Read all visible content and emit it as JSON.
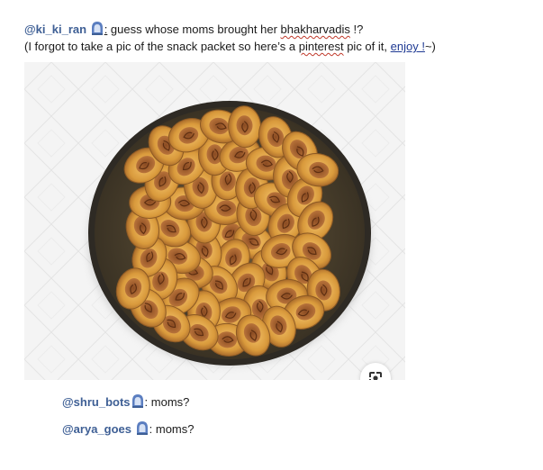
{
  "post": {
    "author": "@ki_ki_ran",
    "author_separator": ":",
    "line1_before": " guess whose moms brought her ",
    "line1_squiggle_word": "bhakharvadis",
    "line1_after": " !?",
    "line2_before": "(I forgot to take a pic of the snack packet so here’s a ",
    "line2_squiggle_word": "pinterest",
    "line2_middle": " pic of it, ",
    "line2_link": "enjoy !",
    "line2_after": "~)"
  },
  "image": {
    "subject": "bowl of bhakharvadi snacks",
    "lens_icon": "google-lens-icon"
  },
  "replies": [
    {
      "author": "@shru_bots",
      "separator": ":",
      "text": " moms?"
    },
    {
      "author": "@arya_goes",
      "separator": ":",
      "text": " moms?"
    }
  ],
  "colors": {
    "mention": "#3e5f95",
    "hood_icon": "#5b7ec0",
    "squiggle": "#c0392b",
    "link": "#1f3a93",
    "bowl_rim": "#2e2a24"
  }
}
